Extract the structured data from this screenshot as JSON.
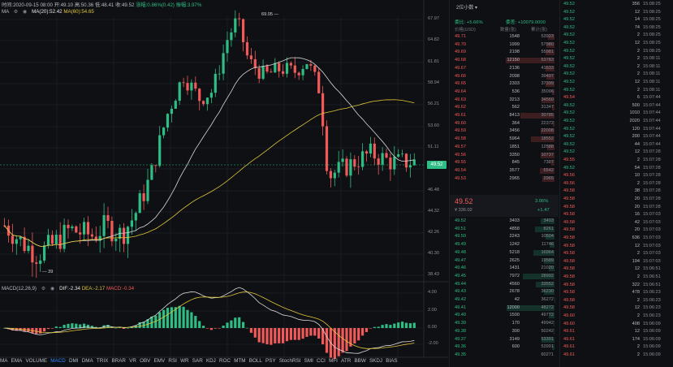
{
  "info": {
    "time_label": "时间:2020-09-15 08:00",
    "open": "开:49.10",
    "high": "高:50.36",
    "low": "低:48.41",
    "close": "收:49.52",
    "change": "涨幅:0.86%(0.42)",
    "amplitude": "振幅:3.97%"
  },
  "ma_legend": {
    "name": "MA",
    "ma20": "MA(20):52.42",
    "ma60": "MA(60):54.65"
  },
  "chart_data": {
    "type": "candlestick",
    "y_ticks": [
      "67.97",
      "64.82",
      "61.81",
      "58.94",
      "56.21",
      "53.60",
      "51.11",
      "48.74",
      "46.48",
      "44.32",
      "42.26",
      "40.30",
      "38.43"
    ],
    "last_price": "49.52",
    "high_label": "69.05",
    "low_label": "39",
    "macd_ticks": [
      "4.00",
      "2.00",
      "0.00",
      "-2.00"
    ]
  },
  "macd_legend": {
    "name": "MACD(12,26,9)",
    "dif": "DIF:-2.34",
    "dea": "DEA:-2.17",
    "macd": "MACD:-0.34"
  },
  "indicators": [
    "MA",
    "EMA",
    "VOLUME",
    "MACD",
    "DMI",
    "DMA",
    "TRIX",
    "BRAR",
    "VR",
    "OBV",
    "EMV",
    "RSI",
    "WR",
    "SAR",
    "KDJ",
    "ROC",
    "MTM",
    "BOLL",
    "PSY",
    "StochRSI",
    "SMI",
    "CCI",
    "MFI",
    "ATR",
    "BBW",
    "SKDJ",
    "BIAS"
  ],
  "active_indicator": "MACD",
  "book": {
    "ratio_label": "委比: +5.66%",
    "diff_label": "委差: +10079.0000",
    "depth_label": "2位小数",
    "head_price": "价格(USD)",
    "head_qty": "数量(张)",
    "head_cum": "累计(张)",
    "asks": [
      [
        "49.71",
        "1548",
        "53923"
      ],
      [
        "49.70",
        "1999",
        "57980"
      ],
      [
        "49.69",
        "2198",
        "55981"
      ],
      [
        "49.68",
        "12150",
        "53783"
      ],
      [
        "49.67",
        "2136",
        "41633"
      ],
      [
        "49.66",
        "2098",
        "39497"
      ],
      [
        "49.65",
        "2303",
        "37399"
      ],
      [
        "49.64",
        "536",
        "35096"
      ],
      [
        "49.63",
        "3213",
        "34560"
      ],
      [
        "49.62",
        "562",
        "31347"
      ],
      [
        "49.61",
        "8413",
        "30785"
      ],
      [
        "49.60",
        "364",
        "22372"
      ],
      [
        "49.59",
        "3456",
        "22008"
      ],
      [
        "49.58",
        "5964",
        "18552"
      ],
      [
        "49.57",
        "1851",
        "12588"
      ],
      [
        "49.56",
        "3350",
        "10737"
      ],
      [
        "49.55",
        "845",
        "7387"
      ],
      [
        "49.54",
        "3577",
        "6542"
      ],
      [
        "49.53",
        "2965",
        "2965"
      ]
    ],
    "mid_price": "49.52",
    "mid_sub": "¥ 336.02",
    "mid_pct": "3.06%",
    "mid_chg": "+1.47",
    "bids": [
      [
        "49.52",
        "3403",
        "3403"
      ],
      [
        "49.51",
        "4858",
        "8261"
      ],
      [
        "49.50",
        "2243",
        "10504"
      ],
      [
        "49.49",
        "1242",
        "11746"
      ],
      [
        "49.48",
        "5218",
        "16964"
      ],
      [
        "49.47",
        "2625",
        "19589"
      ],
      [
        "49.46",
        "1431",
        "21020"
      ],
      [
        "49.45",
        "7972",
        "28992"
      ],
      [
        "49.44",
        "4560",
        "33552"
      ],
      [
        "49.43",
        "2678",
        "36230"
      ],
      [
        "49.42",
        "42",
        "36272"
      ],
      [
        "49.41",
        "12000",
        "48272"
      ],
      [
        "49.40",
        "1500",
        "49772"
      ],
      [
        "49.39",
        "170",
        "49942"
      ],
      [
        "49.38",
        "300",
        "50242"
      ],
      [
        "49.37",
        "3149",
        "53391"
      ],
      [
        "49.36",
        "600",
        "53991"
      ],
      [
        "49.35",
        "",
        "60271"
      ]
    ]
  },
  "trades": [
    [
      "49.52",
      "356",
      "15:08:25",
      "up"
    ],
    [
      "49.52",
      "12",
      "15:08:25",
      "up"
    ],
    [
      "49.52",
      "14",
      "15:08:25",
      "up"
    ],
    [
      "49.52",
      "74",
      "15:08:25",
      "up"
    ],
    [
      "49.52",
      "2",
      "15:08:25",
      "up"
    ],
    [
      "49.52",
      "12",
      "15:08:25",
      "up"
    ],
    [
      "49.52",
      "2",
      "15:08:25",
      "up"
    ],
    [
      "49.52",
      "2",
      "15:08:11",
      "up"
    ],
    [
      "49.52",
      "2",
      "15:08:11",
      "up"
    ],
    [
      "49.52",
      "2",
      "15:08:11",
      "up"
    ],
    [
      "49.52",
      "12",
      "15:08:11",
      "up"
    ],
    [
      "49.52",
      "2",
      "15:08:11",
      "up"
    ],
    [
      "49.54",
      "6",
      "15:07:44",
      "dn"
    ],
    [
      "49.52",
      "500",
      "15:07:44",
      "up"
    ],
    [
      "49.52",
      "1010",
      "15:07:44",
      "up"
    ],
    [
      "49.52",
      "2020",
      "15:07:44",
      "up"
    ],
    [
      "49.52",
      "120",
      "15:07:44",
      "up"
    ],
    [
      "49.52",
      "200",
      "15:07:44",
      "up"
    ],
    [
      "49.52",
      "44",
      "15:07:44",
      "up"
    ],
    [
      "49.52",
      "12",
      "15:07:28",
      "up"
    ],
    [
      "49.55",
      "2",
      "15:07:28",
      "dn"
    ],
    [
      "49.52",
      "54",
      "15:07:28",
      "up"
    ],
    [
      "49.56",
      "10",
      "15:07:28",
      "dn"
    ],
    [
      "49.56",
      "2",
      "15:07:28",
      "dn"
    ],
    [
      "49.58",
      "38",
      "15:07:28",
      "dn"
    ],
    [
      "49.58",
      "20",
      "15:07:28",
      "dn"
    ],
    [
      "49.58",
      "20",
      "15:07:28",
      "dn"
    ],
    [
      "49.58",
      "16",
      "15:07:03",
      "dn"
    ],
    [
      "49.58",
      "42",
      "15:07:03",
      "dn"
    ],
    [
      "49.58",
      "20",
      "15:07:03",
      "dn"
    ],
    [
      "49.58",
      "636",
      "15:07:03",
      "dn"
    ],
    [
      "49.58",
      "12",
      "15:07:03",
      "dn"
    ],
    [
      "49.58",
      "2",
      "15:07:03",
      "dn"
    ],
    [
      "49.58",
      "194",
      "15:07:03",
      "dn"
    ],
    [
      "49.58",
      "12",
      "15:06:51",
      "dn"
    ],
    [
      "49.58",
      "2",
      "15:06:51",
      "dn"
    ],
    [
      "49.58",
      "322",
      "15:06:51",
      "dn"
    ],
    [
      "49.58",
      "478",
      "15:06:23",
      "dn"
    ],
    [
      "49.58",
      "2",
      "15:06:23",
      "dn"
    ],
    [
      "49.58",
      "12",
      "15:06:23",
      "dn"
    ],
    [
      "49.60",
      "2",
      "15:06:23",
      "dn"
    ],
    [
      "49.60",
      "408",
      "15:06:09",
      "dn"
    ],
    [
      "49.61",
      "12",
      "15:06:09",
      "dn"
    ],
    [
      "49.61",
      "174",
      "15:06:09",
      "dn"
    ],
    [
      "49.61",
      "2",
      "15:06:09",
      "dn"
    ],
    [
      "49.61",
      "2",
      "15:06:09",
      "dn"
    ]
  ]
}
